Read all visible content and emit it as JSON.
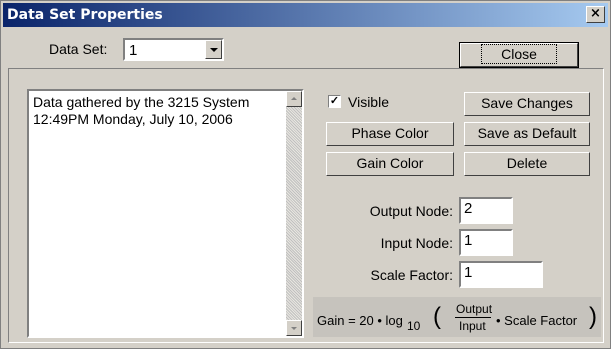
{
  "window": {
    "title": "Data Set Properties",
    "close_glyph": "×"
  },
  "dataset": {
    "label": "Data Set:",
    "selected": "1"
  },
  "buttons": {
    "close": "Close",
    "save_changes": "Save Changes",
    "phase_color": "Phase Color",
    "save_as_default": "Save as Default",
    "gain_color": "Gain Color",
    "delete": "Delete"
  },
  "description": "Data gathered by the 3215 System\n12:49PM Monday, July 10, 2006",
  "visible": {
    "label": "Visible",
    "checked": true,
    "check_glyph": "✓"
  },
  "fields": {
    "output_node": {
      "label": "Output Node:",
      "value": "2"
    },
    "input_node": {
      "label": "Input Node:",
      "value": "1"
    },
    "scale_factor": {
      "label": "Scale Factor:",
      "value": "1"
    }
  },
  "formula": {
    "prefix": "Gain = 20 • log",
    "subscript": "10",
    "numerator": "Output",
    "denominator": "Input",
    "suffix": "• Scale Factor",
    "open_paren": "(",
    "close_paren": ")"
  }
}
